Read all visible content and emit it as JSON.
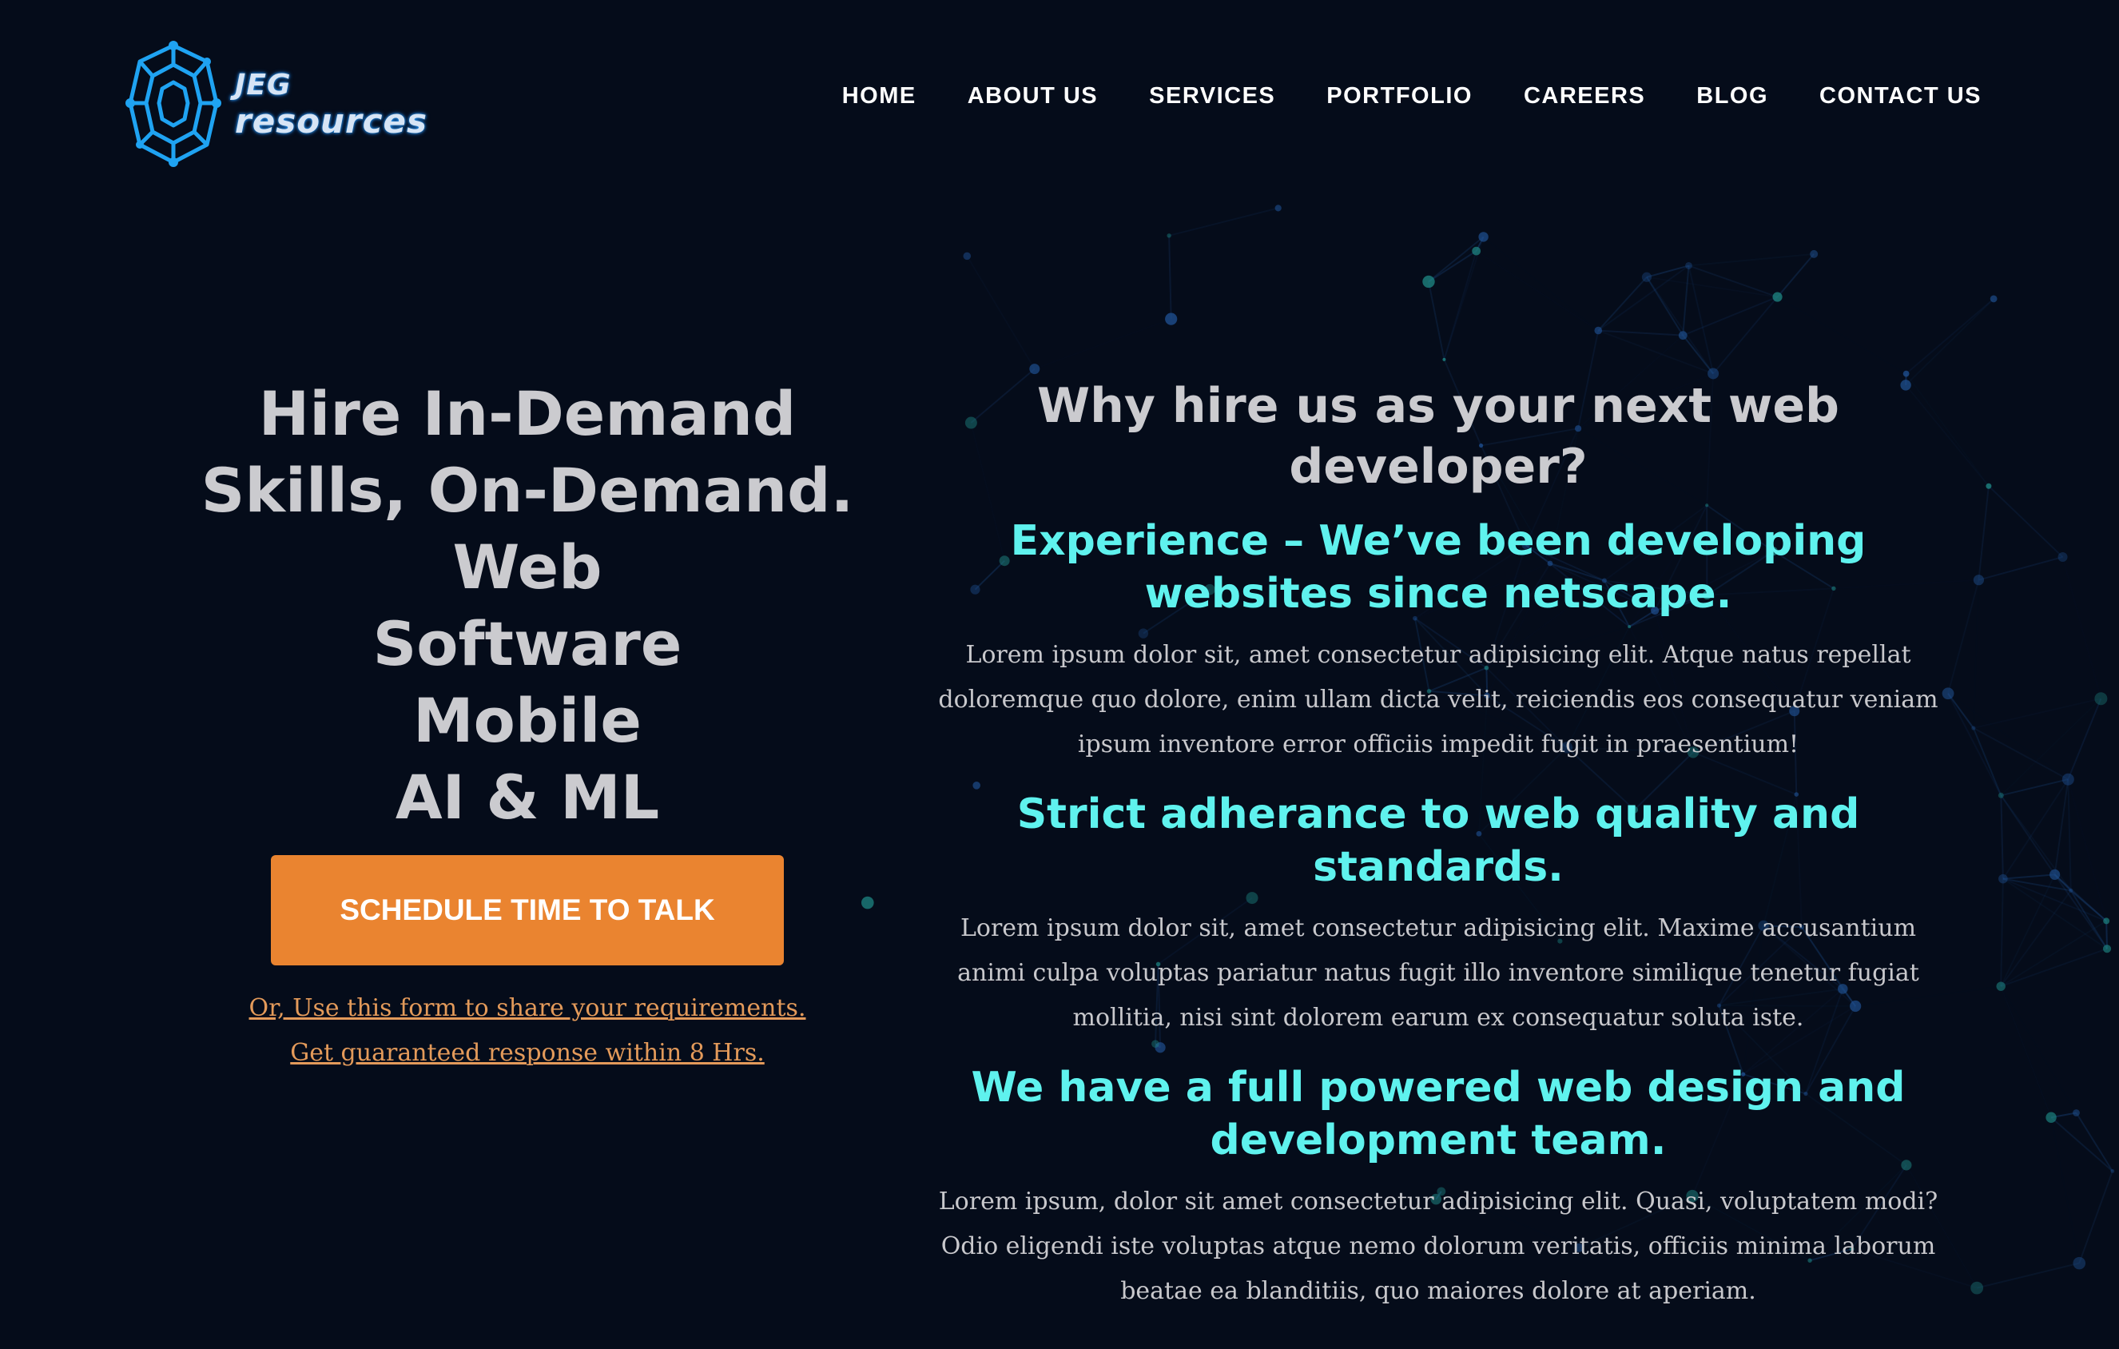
{
  "brand": {
    "logo_line1": "JEG",
    "logo_line2": "resources"
  },
  "nav": {
    "items": [
      {
        "label": "HOME"
      },
      {
        "label": "ABOUT US"
      },
      {
        "label": "SERVICES"
      },
      {
        "label": "PORTFOLIO"
      },
      {
        "label": "CAREERS"
      },
      {
        "label": "BLOG"
      },
      {
        "label": "CONTACT US"
      }
    ]
  },
  "hero": {
    "title_lines": [
      "Hire In-Demand",
      "Skills, On-Demand.",
      "Web",
      "Software",
      "Mobile",
      "AI & ML"
    ],
    "cta_label": "SCHEDULE TIME TO TALK",
    "form_link_text": "Or, Use this form to share your requirements. Get guaranteed response within 8 Hrs."
  },
  "why": {
    "title": "Why hire us as your next web developer?",
    "features": [
      {
        "heading": "Experience – We’ve been developing websites since netscape.",
        "text": "Lorem ipsum dolor sit, amet consectetur adipisicing elit. Atque natus repellat doloremque quo dolore, enim ullam dicta velit, reiciendis eos consequatur veniam ipsum inventore error officiis impedit fugit in praesentium!"
      },
      {
        "heading": "Strict adherance to web quality and standards.",
        "text": "Lorem ipsum dolor sit, amet consectetur adipisicing elit. Maxime accusantium animi culpa voluptas pariatur natus fugit illo inventore similique tenetur fugiat mollitia, nisi sint dolorem earum ex consequatur soluta iste."
      },
      {
        "heading": "We have a full powered web design and development team.",
        "text": "Lorem ipsum, dolor sit amet consectetur adipisicing elit. Quasi, voluptatem modi? Odio eligendi iste voluptas atque nemo dolorum veritatis, officiis minima laborum beatae ea blanditiis, quo maiores dolore at aperiam."
      }
    ]
  },
  "colors": {
    "background": "#050c1a",
    "accent_cyan": "#5ff2ee",
    "cta_orange": "#ea8430",
    "link_orange": "#e39a5a",
    "heading_gray": "#cbcbcf",
    "logo_blue": "#1fa3f2"
  },
  "icons": {
    "logo_mark": "circuit-octagon-icon",
    "background": "network-constellation-graphic"
  }
}
